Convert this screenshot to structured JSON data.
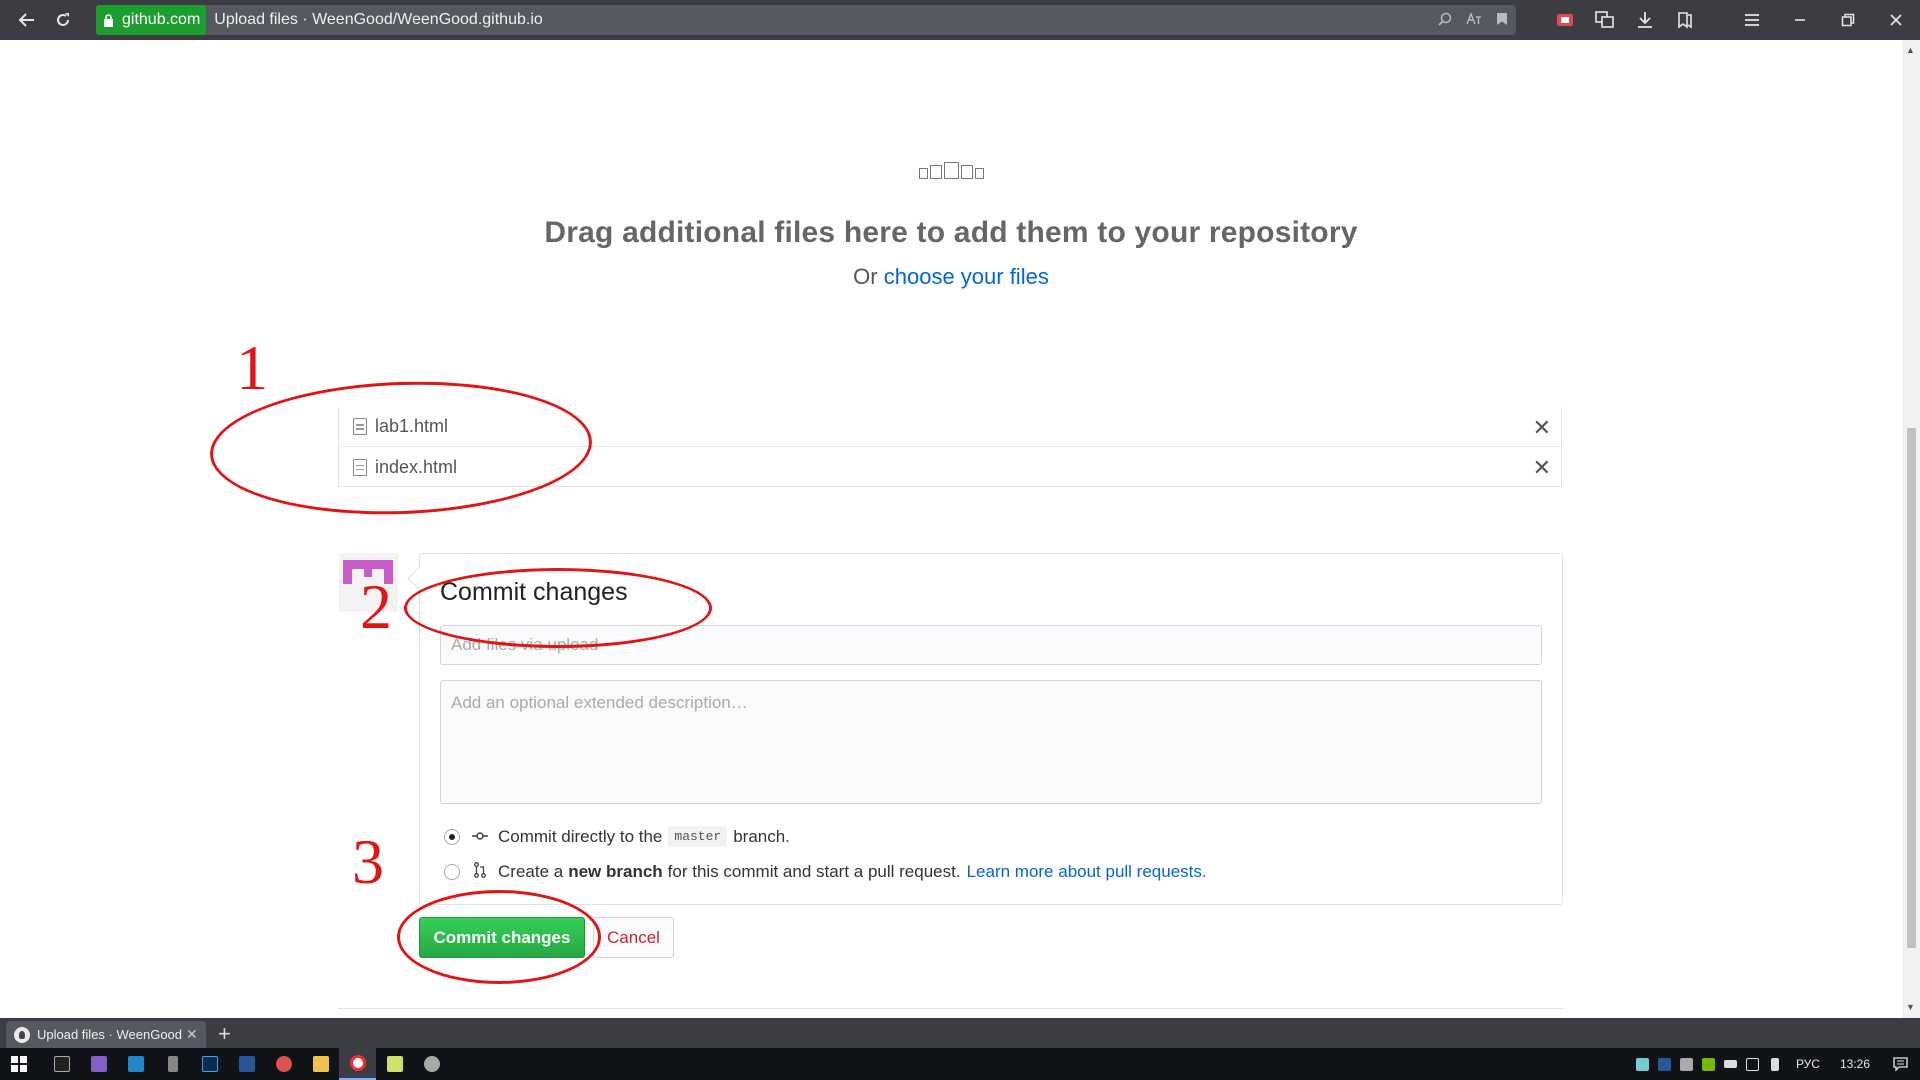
{
  "browser": {
    "domain": "github.com",
    "page_title": "Upload files · WeenGood/WeenGood.github.io"
  },
  "upload": {
    "drag_title": "Drag additional files here to add them to your repository",
    "or_text": "Or",
    "choose_link": "choose your files"
  },
  "files": [
    {
      "name": "lab1.html"
    },
    {
      "name": "index.html"
    }
  ],
  "commit": {
    "heading": "Commit changes",
    "summary_placeholder": "Add files via upload",
    "description_placeholder": "Add an optional extended description…",
    "option_direct_prefix": "Commit directly to the",
    "branch_name": "master",
    "option_direct_suffix": "branch.",
    "option_new_prefix": "Create a",
    "option_new_bold": "new branch",
    "option_new_suffix": "for this commit and start a pull request.",
    "option_new_link": "Learn more about pull requests.",
    "commit_button": "Commit changes",
    "cancel_button": "Cancel"
  },
  "annotations": [
    "1",
    "2",
    "3"
  ],
  "tab": {
    "title": "Upload files · WeenGood/WeenGood.github.io"
  },
  "taskbar": {
    "language": "РУС",
    "time": "13:26"
  },
  "colors": {
    "accent_link": "#0366d6",
    "commit_green": "#2cbe4e",
    "annotation_red": "#e01616",
    "cancel_red": "#cb2431"
  }
}
